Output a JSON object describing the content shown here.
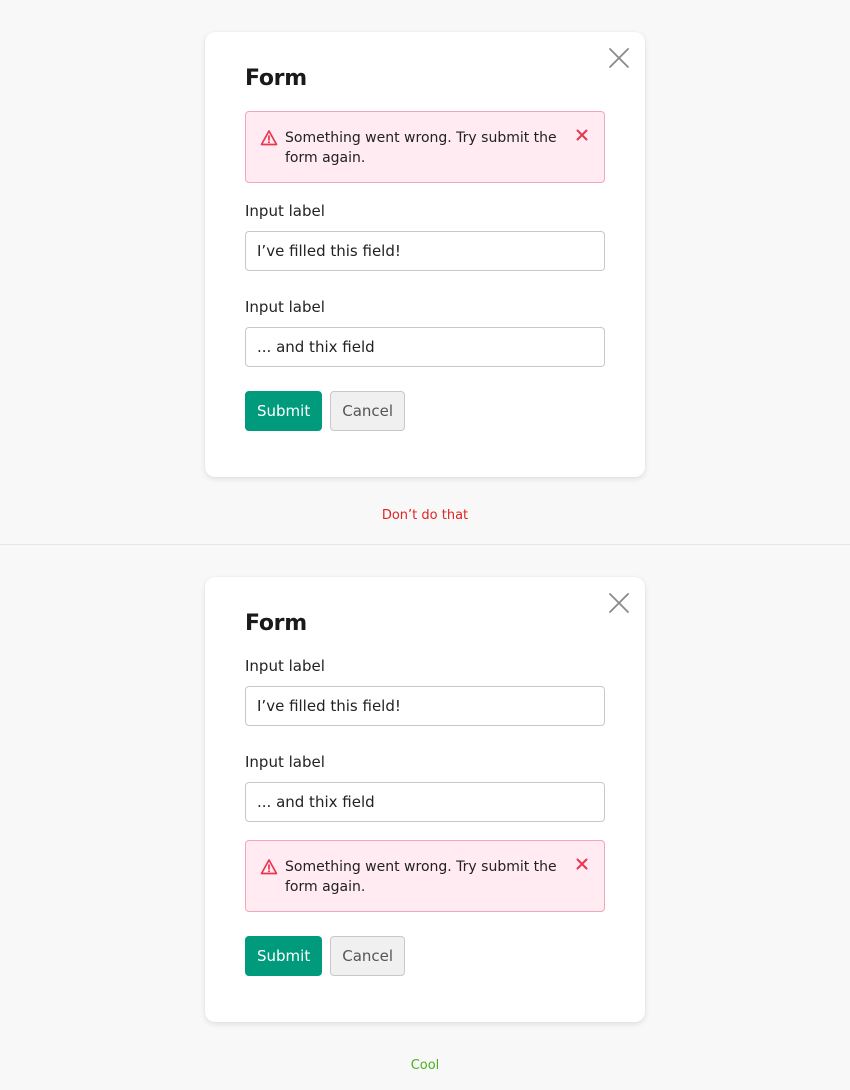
{
  "colors": {
    "primary": "#009b7d",
    "error_border": "#f3a7b6",
    "error_background": "#ffebf1",
    "error_icon": "#e8364f",
    "bad_caption": "#e02424",
    "good_caption": "#4caf1e"
  },
  "examples": [
    {
      "title": "Form",
      "alert": {
        "message": "Something went wrong. Try submit the form again.",
        "icon": "warning-triangle-icon",
        "dismiss_icon": "close-icon"
      },
      "fields": [
        {
          "label": "Input label",
          "value": "I’ve filled this field!"
        },
        {
          "label": "Input label",
          "value": "... and thix field"
        }
      ],
      "submit_label": "Submit",
      "cancel_label": "Cancel",
      "caption": "Don’t do that"
    },
    {
      "title": "Form",
      "alert": {
        "message": "Something went wrong. Try submit the form again.",
        "icon": "warning-triangle-icon",
        "dismiss_icon": "close-icon"
      },
      "fields": [
        {
          "label": "Input label",
          "value": "I’ve filled this field!"
        },
        {
          "label": "Input label",
          "value": "... and thix field"
        }
      ],
      "submit_label": "Submit",
      "cancel_label": "Cancel",
      "caption": "Cool"
    }
  ]
}
